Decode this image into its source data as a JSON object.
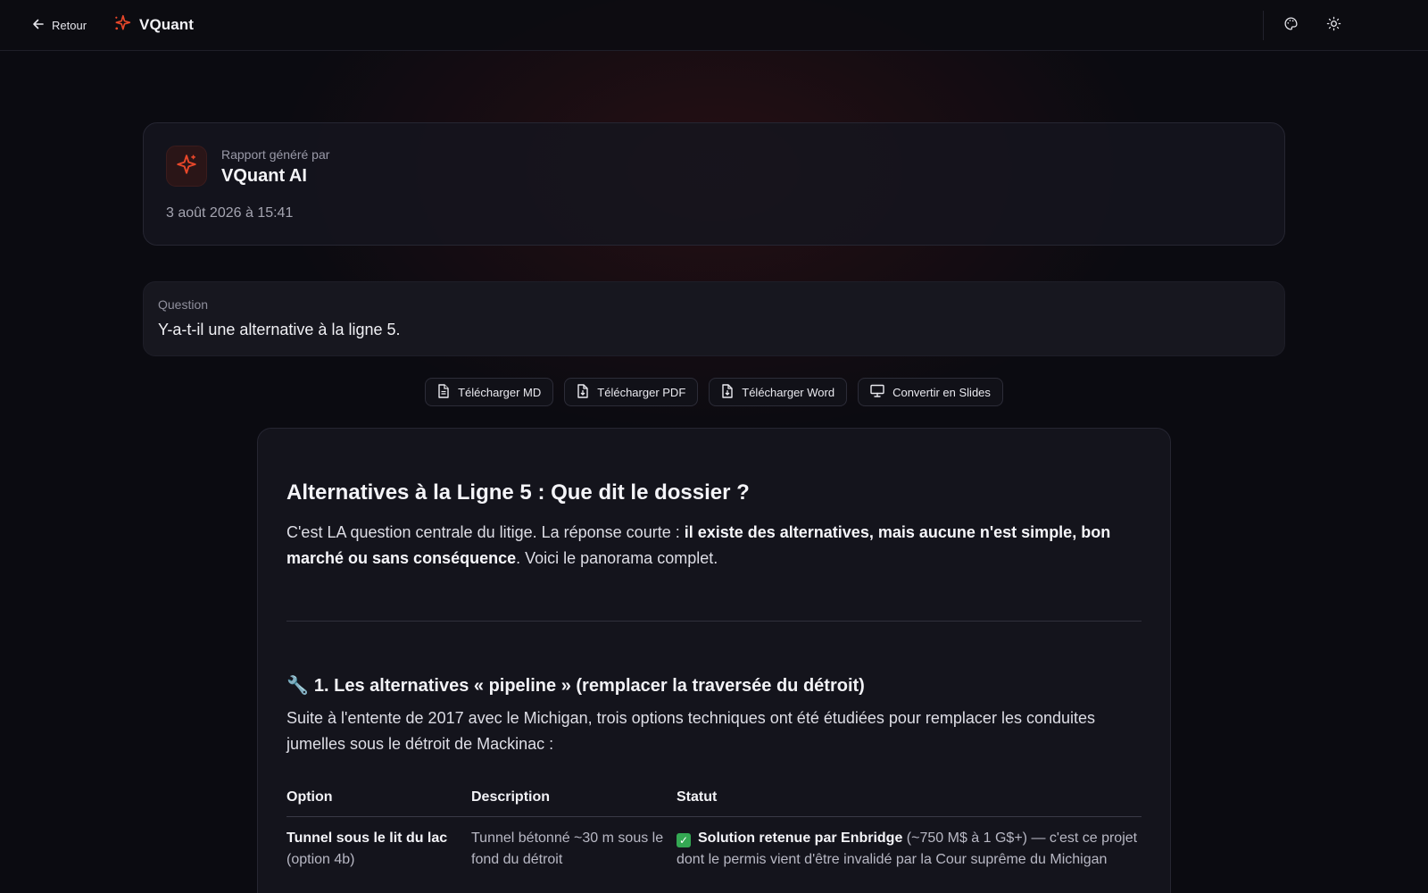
{
  "topbar": {
    "back_label": "Retour",
    "brand_name": "VQuant",
    "accent_color": "#e8472a",
    "icons": [
      "arrow-left-icon",
      "sparkle-logo-icon",
      "palette-icon",
      "sun-icon"
    ]
  },
  "report": {
    "generated_by_label": "Rapport généré par",
    "generator_name": "VQuant AI",
    "date": "3 août 2026 à 15:41"
  },
  "question": {
    "label": "Question",
    "text": "Y-a-t-il une alternative à la ligne 5."
  },
  "actions": [
    {
      "label": "Télécharger MD",
      "icon": "file-text-icon"
    },
    {
      "label": "Télécharger PDF",
      "icon": "file-download-icon"
    },
    {
      "label": "Télécharger Word",
      "icon": "file-word-icon"
    },
    {
      "label": "Convertir en Slides",
      "icon": "presentation-icon"
    }
  ],
  "content": {
    "title": "Alternatives à la Ligne 5 : Que dit le dossier ?",
    "intro_prefix": "C'est LA question centrale du litige. La réponse courte : ",
    "intro_bold": "il existe des alternatives, mais aucune n'est simple, bon marché ou sans conséquence",
    "intro_suffix": ". Voici le panorama complet.",
    "section1_emoji": "🔧",
    "section1_title": "1. Les alternatives « pipeline » (remplacer la traversée du détroit)",
    "section1_text": "Suite à l'entente de 2017 avec le Michigan, trois options techniques ont été étudiées pour remplacer les conduites jumelles sous le détroit de Mackinac :",
    "table": {
      "headers": [
        "Option",
        "Description",
        "Statut"
      ],
      "rows": [
        {
          "option_bold": "Tunnel sous le lit du lac",
          "option_rest": "(option 4b)",
          "description": "Tunnel bétonné ~30 m sous le fond du détroit",
          "status_check": "✓",
          "status_bold": "Solution retenue par Enbridge",
          "status_rest": " (~750 M$ à 1 G$+) — c'est ce projet dont le permis vient d'être invalidé par la Cour suprême du Michigan"
        }
      ]
    }
  }
}
